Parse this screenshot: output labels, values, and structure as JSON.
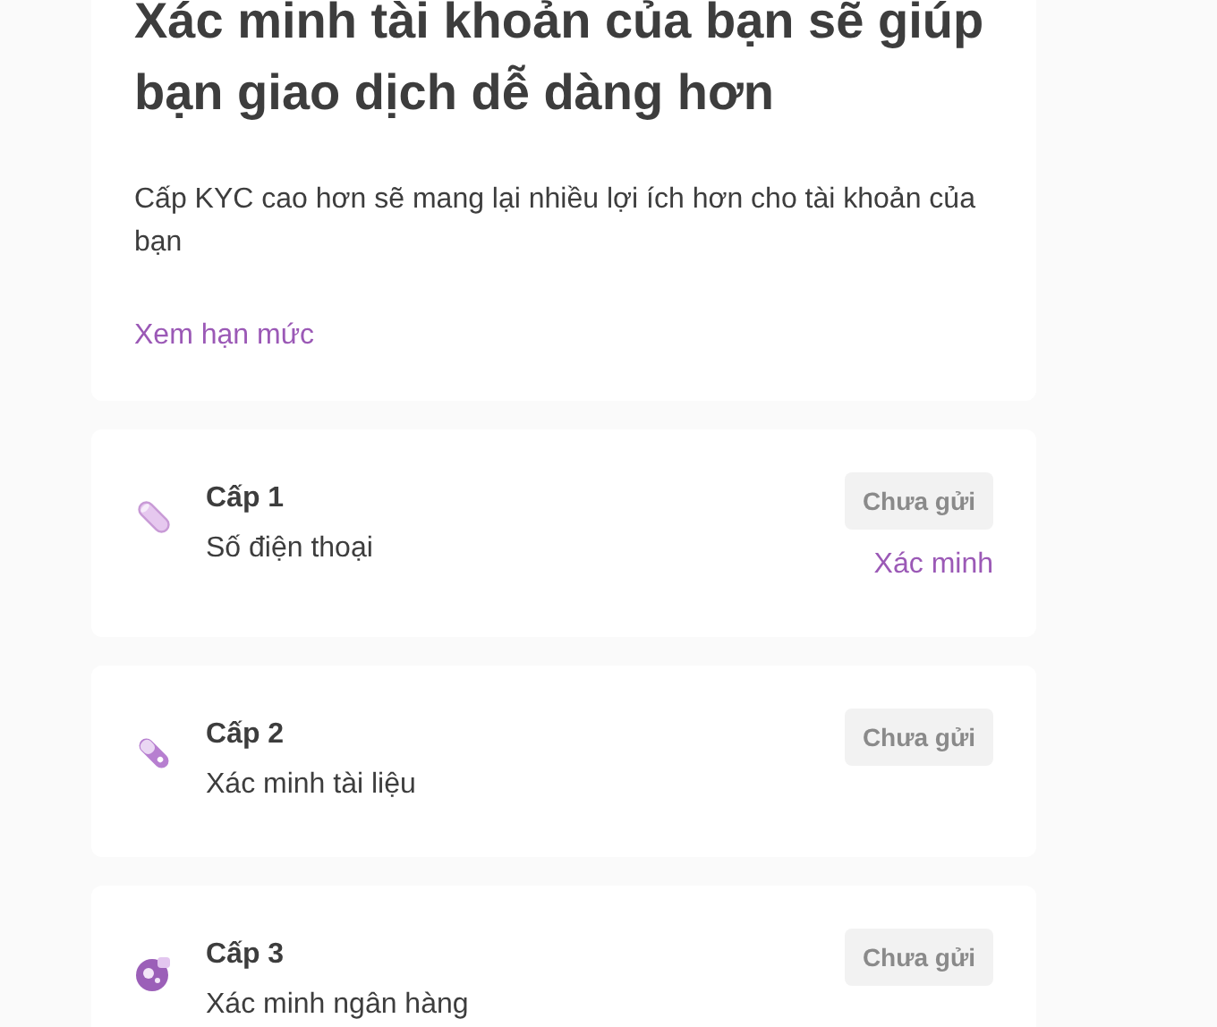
{
  "intro": {
    "title": "Xác minh tài khoản của bạn sẽ giúp bạn giao dịch dễ dàng hơn",
    "description": "Cấp KYC cao hơn sẽ mang lại nhiều lợi ích hơn cho tài khoản của bạn",
    "link": "Xem hạn mức"
  },
  "levels": [
    {
      "title": "Cấp 1",
      "subtitle": "Số điện thoại",
      "status": "Chưa gửi",
      "action": "Xác minh"
    },
    {
      "title": "Cấp 2",
      "subtitle": "Xác minh tài liệu",
      "status": "Chưa gửi"
    },
    {
      "title": "Cấp 3",
      "subtitle": "Xác minh ngân hàng",
      "status": "Chưa gửi"
    }
  ]
}
